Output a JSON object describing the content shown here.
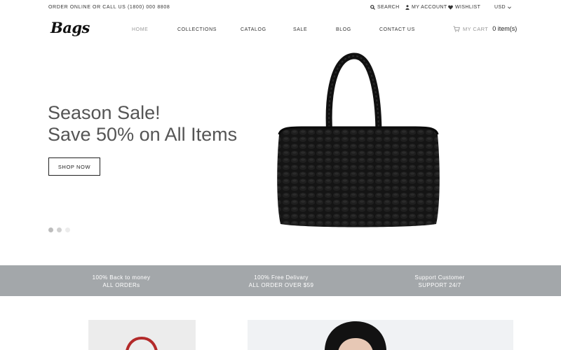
{
  "topbar": {
    "order_text": "ORDER ONLINE OR CALL US (1800) 000 8808",
    "search_label": "SEARCH",
    "account_label": "MY ACCOUNT",
    "wishlist_label": "WISHLIST",
    "currency": "USD"
  },
  "header": {
    "logo": "Bags",
    "nav": [
      {
        "label": "HOME",
        "active": true
      },
      {
        "label": "COLLECTIONS",
        "active": false
      },
      {
        "label": "CATALOG",
        "active": false
      },
      {
        "label": "SALE",
        "active": false
      },
      {
        "label": "BLOG",
        "active": false
      },
      {
        "label": "CONTACT US",
        "active": false
      }
    ],
    "cart_label": "MY CART",
    "cart_count": "0 item(s)"
  },
  "hero": {
    "title_line1": "Season Sale!",
    "title_line2": "Save 50% on All Items",
    "button": "SHOP NOW",
    "slides_total": 3,
    "slide_active": 1
  },
  "features": [
    {
      "line1": "100% Back to money",
      "line2": "ALL ORDERs"
    },
    {
      "line1": "100% Free Delivary",
      "line2": "ALL ORDER OVER $59"
    },
    {
      "line1": "Support Customer",
      "line2": "SUPPORT 24/7"
    }
  ],
  "colors": {
    "feature_band": "#a3a7aa",
    "hero_text": "#555555",
    "bag": "#111111",
    "red_bag_handle": "#b32a2a"
  }
}
